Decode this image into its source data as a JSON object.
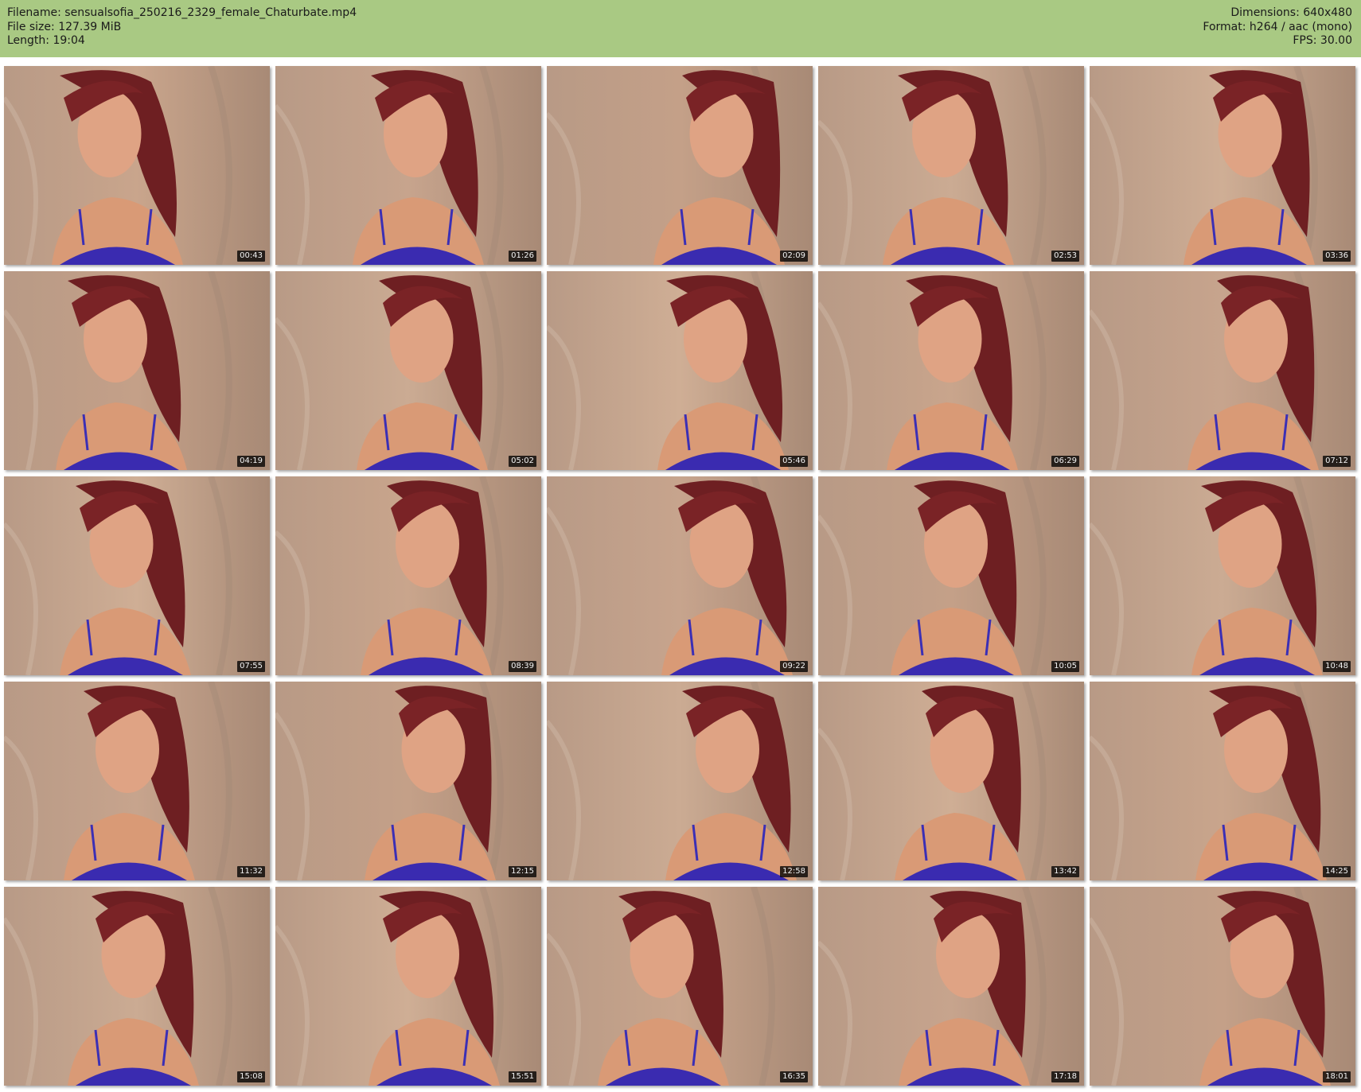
{
  "header": {
    "filename_line": "Filename: sensualsofia_250216_2329_female_Chaturbate.mp4",
    "filesize_line": "File size: 127.39 MiB",
    "length_line": "Length: 19:04",
    "dimensions_line": "Dimensions: 640x480",
    "format_line": "Format: h264 / aac (mono)",
    "fps_line": "FPS: 30.00"
  },
  "colors": {
    "header_background": "#a9c983",
    "timestamp_background": "#000000",
    "timestamp_text": "#f2f2f2"
  },
  "thumbnails": [
    {
      "time": "00:43"
    },
    {
      "time": "01:26"
    },
    {
      "time": "02:09"
    },
    {
      "time": "02:53"
    },
    {
      "time": "03:36"
    },
    {
      "time": "04:19"
    },
    {
      "time": "05:02"
    },
    {
      "time": "05:46"
    },
    {
      "time": "06:29"
    },
    {
      "time": "07:12"
    },
    {
      "time": "07:55"
    },
    {
      "time": "08:39"
    },
    {
      "time": "09:22"
    },
    {
      "time": "10:05"
    },
    {
      "time": "10:48"
    },
    {
      "time": "11:32"
    },
    {
      "time": "12:15"
    },
    {
      "time": "12:58"
    },
    {
      "time": "13:42"
    },
    {
      "time": "14:25"
    },
    {
      "time": "15:08"
    },
    {
      "time": "15:51"
    },
    {
      "time": "16:35"
    },
    {
      "time": "17:18"
    },
    {
      "time": "18:01"
    }
  ]
}
